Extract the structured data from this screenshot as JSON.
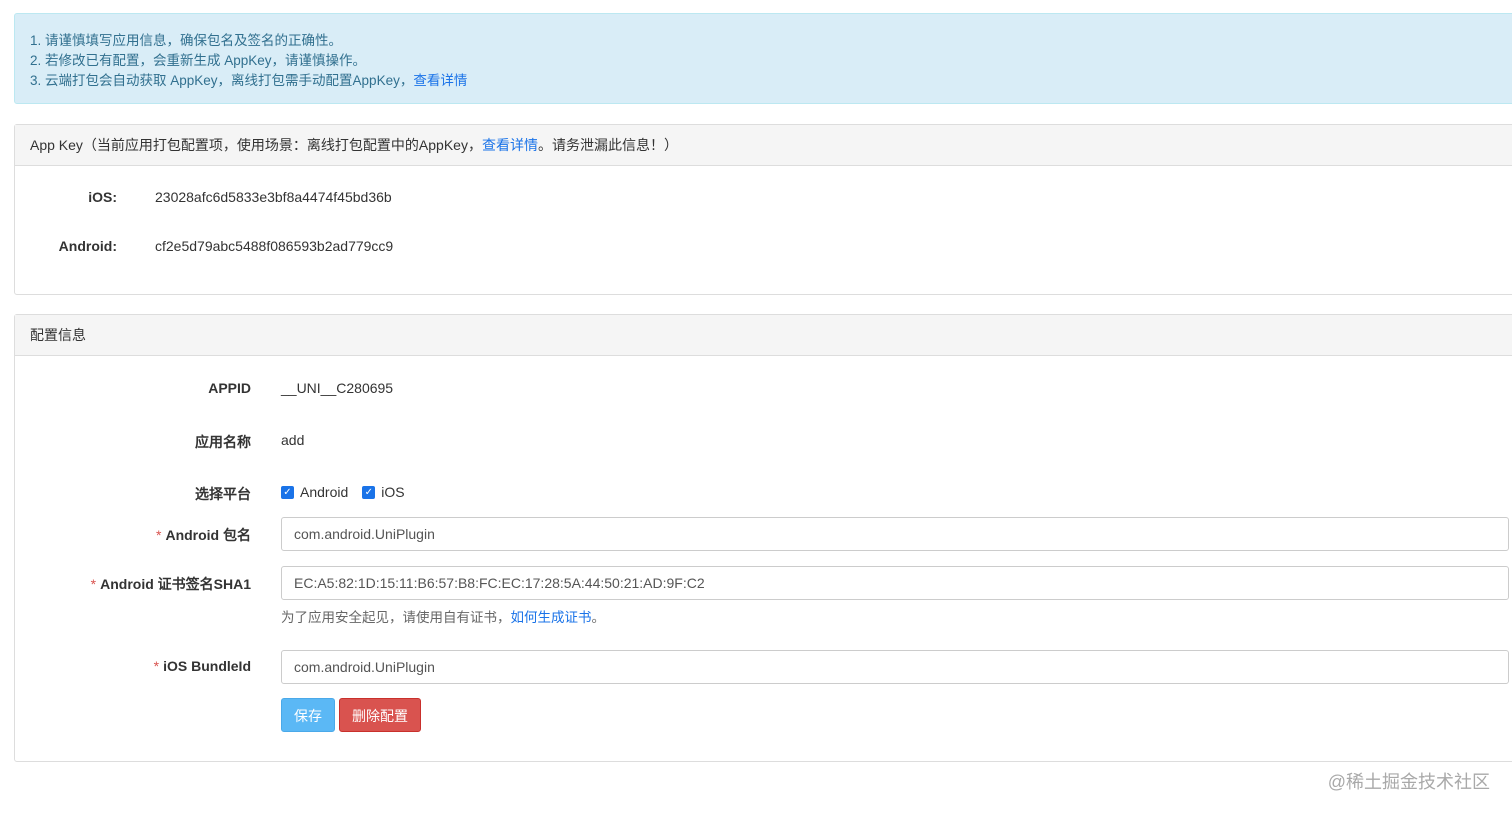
{
  "notice": {
    "line1": "1. 请谨慎填写应用信息，确保包名及签名的正确性。",
    "line2": "2. 若修改已有配置，会重新生成 AppKey，请谨慎操作。",
    "line3_text": "3. 云端打包会自动获取 AppKey，离线打包需手动配置AppKey，",
    "line3_link": "查看详情"
  },
  "appkey_panel": {
    "heading_prefix": "App Key（当前应用打包配置项，使用场景：离线打包配置中的AppKey，",
    "heading_link": "查看详情",
    "heading_suffix": "。请务泄漏此信息！）",
    "ios_label": "iOS:",
    "ios_value": "23028afc6d5833e3bf8a4474f45bd36b",
    "android_label": "Android:",
    "android_value": "cf2e5d79abc5488f086593b2ad779cc9"
  },
  "config_panel": {
    "heading": "配置信息",
    "appid_label": "APPID",
    "appid_value": "__UNI__C280695",
    "appname_label": "应用名称",
    "appname_value": "add",
    "platform_label": "选择平台",
    "platforms": [
      {
        "label": "Android",
        "checked": true
      },
      {
        "label": "iOS",
        "checked": true
      }
    ],
    "required_mark": "*",
    "android_pkg_label": "Android 包名",
    "android_pkg_value": "com.android.UniPlugin",
    "android_sha1_label": "Android 证书签名SHA1",
    "android_sha1_value": "EC:A5:82:1D:15:11:B6:57:B8:FC:EC:17:28:5A:44:50:21:AD:9F:C2",
    "hint_text": "为了应用安全起见，请使用自有证书，",
    "hint_link": "如何生成证书",
    "hint_suffix": "。",
    "ios_bundle_label": "iOS BundleId",
    "ios_bundle_value": "com.android.UniPlugin",
    "save_label": "保存",
    "delete_label": "删除配置"
  },
  "watermark": "@稀土掘金技术社区",
  "colors": {
    "notice_bg": "#d9edf7",
    "link": "#1a73e8",
    "save_button": "#5bb8f5",
    "delete_button": "#d9534f",
    "required": "#d9534f"
  }
}
